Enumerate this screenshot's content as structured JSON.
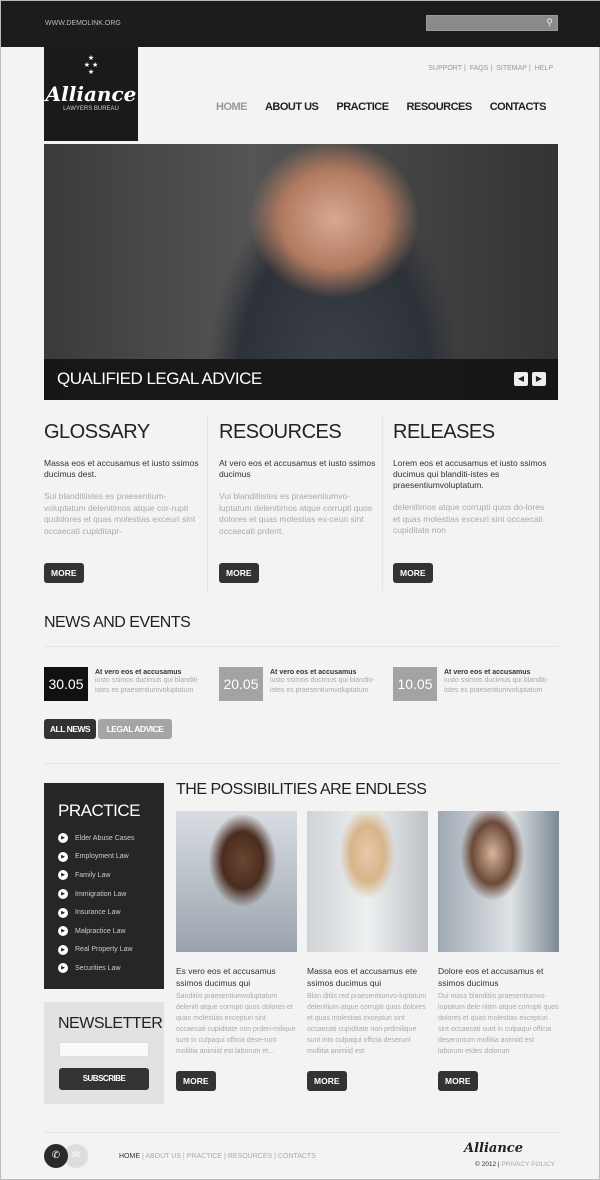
{
  "header": {
    "url": "WWW.DEMOLINK.ORG",
    "search_placeholder": "",
    "logo": {
      "name": "Alliance",
      "subtitle": "LAWYERS BUREAU"
    },
    "util_links": [
      "SUPPORT",
      "FAQS",
      "SITEMAP",
      "HELP"
    ],
    "nav": [
      "HOME",
      "ABOUT US",
      "PRACTICE",
      "RESOURCES",
      "CONTACTS"
    ],
    "active_nav": "HOME"
  },
  "slider": {
    "caption": "QUALIFIED LEGAL ADVICE",
    "prev": "◀",
    "next": "▶"
  },
  "columns": [
    {
      "title": "GLOSSARY",
      "lead": "Massa eos et accusamus et iusto ssimos ducimus dest.",
      "body": "Sui blanditiistes es praesentium-voluptatum delenitimos atque cor-rupti qudolores et quas molestias exceuri sint occaecati cupiditapr-",
      "button": "MORE"
    },
    {
      "title": "RESOURCES",
      "lead": "At vero eos et accusamus et iusto ssimos ducimus",
      "body": "Vui blanditiistes es praesentiumvo-luptatum delenitimos atque corrupti quos dolores et quas molestias ex-ceuri sint occaecati prdent.",
      "button": "MORE"
    },
    {
      "title": "RELEASES",
      "lead": "Lorem eos et accusamus et iusto ssimos ducimus qui blanditi-istes es praesentiumvoluptatum.",
      "body": "delenitimos atque corrupti quos do-lores et quas molestias exceuri sint occaecati cupiditate non",
      "button": "MORE"
    }
  ],
  "news": {
    "title": "NEWS AND EVENTS",
    "items": [
      {
        "date": "30.05",
        "title": "At vero eos et accusamus",
        "text": "iusto ssimos ducimus qui blanditi-istes es praesentiumvoluptatum"
      },
      {
        "date": "20.05",
        "title": "At vero eos et accusamus",
        "text": "iusto ssimos ducimus qui blanditi-istes es praesentiumvoluptatum"
      },
      {
        "date": "10.05",
        "title": "At vero eos et accusamus",
        "text": "iusto ssimos ducimus qui blanditi-istes es praesentiumvoluptatum"
      }
    ],
    "tabs": [
      "ALL NEWS",
      "LEGAL ADVICE"
    ]
  },
  "practice": {
    "title": "PRACTICE",
    "items": [
      "Elder Abuse Cases",
      "Employment Law",
      "Family Law",
      "Immigration Law",
      "Insurance Law",
      "Malpractice Law",
      "Real Property Law",
      "Securities Law"
    ]
  },
  "newsletter": {
    "title": "NEWSLETTER",
    "input_value": "",
    "button": "SUBSCRIBE"
  },
  "possibilities": {
    "title": "THE POSSIBILITIES ARE ENDLESS",
    "cards": [
      {
        "title": "Es vero eos et accusamus ssimos ducimus qui",
        "text": "Sanditiis praesentiumvoluptatum deleniti atque corrupti quos dolores et quas molestias excepturi sint occaecati cupiditate non prden-milique sunt in culpaqui officia dese-runt mollitia animiid est laborum et...",
        "button": "MORE"
      },
      {
        "title": "Massa eos et accusamus ete ssimos ducimus qui",
        "text": "Blan ditiis red praesentiumvo-luptatum delenitium atque corrupti quos dolores et quas molestias excepturi sint occaecati cupiditate non prdmilique sunt into culpaqui officia deserunt mollitia animiid est",
        "button": "MORE"
      },
      {
        "title": "Dolore eos et accusamus et ssimos ducimus",
        "text": "Dui mass blanditiis praesentiumvo-luptatum dele nitim atque corrupti quos dolores et quas molestias excepturi sint occaecati sunt in culpaqui officia deseruntum mollitia animiid est laborum etdes dolorum",
        "button": "MORE"
      }
    ]
  },
  "footer": {
    "nav": [
      "HOME",
      "ABOUT US",
      "PRACTICE",
      "RESOURCES",
      "CONTACTS"
    ],
    "logo": "Alliance",
    "copyright": "© 2012",
    "privacy": "PRIVACY POLICY"
  },
  "colors": {
    "dark": "#262626",
    "accent_gray": "#9a9a9a",
    "background": "#f3f3f3"
  }
}
